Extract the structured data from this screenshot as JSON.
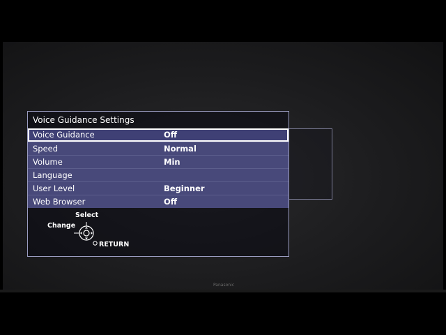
{
  "menu": {
    "title": "Voice Guidance Settings",
    "rows": [
      {
        "label": "Voice Guidance",
        "value": "Off"
      },
      {
        "label": "Speed",
        "value": "Normal"
      },
      {
        "label": "Volume",
        "value": "Min"
      },
      {
        "label": "Language",
        "value": ""
      },
      {
        "label": "User Level",
        "value": "Beginner"
      },
      {
        "label": "Web Browser",
        "value": "Off"
      }
    ],
    "selected_index": 0
  },
  "nav_help": {
    "select_label": "Select",
    "change_label": "Change",
    "return_label": "RETURN"
  },
  "tv": {
    "brand": "Panasonic"
  },
  "colors": {
    "row_background": "#48497a",
    "menu_border": "#9a9cc0",
    "selection_border": "#ffffff"
  },
  "icons": {
    "nav": "directional-pad-icon",
    "return": "return-button-icon"
  }
}
